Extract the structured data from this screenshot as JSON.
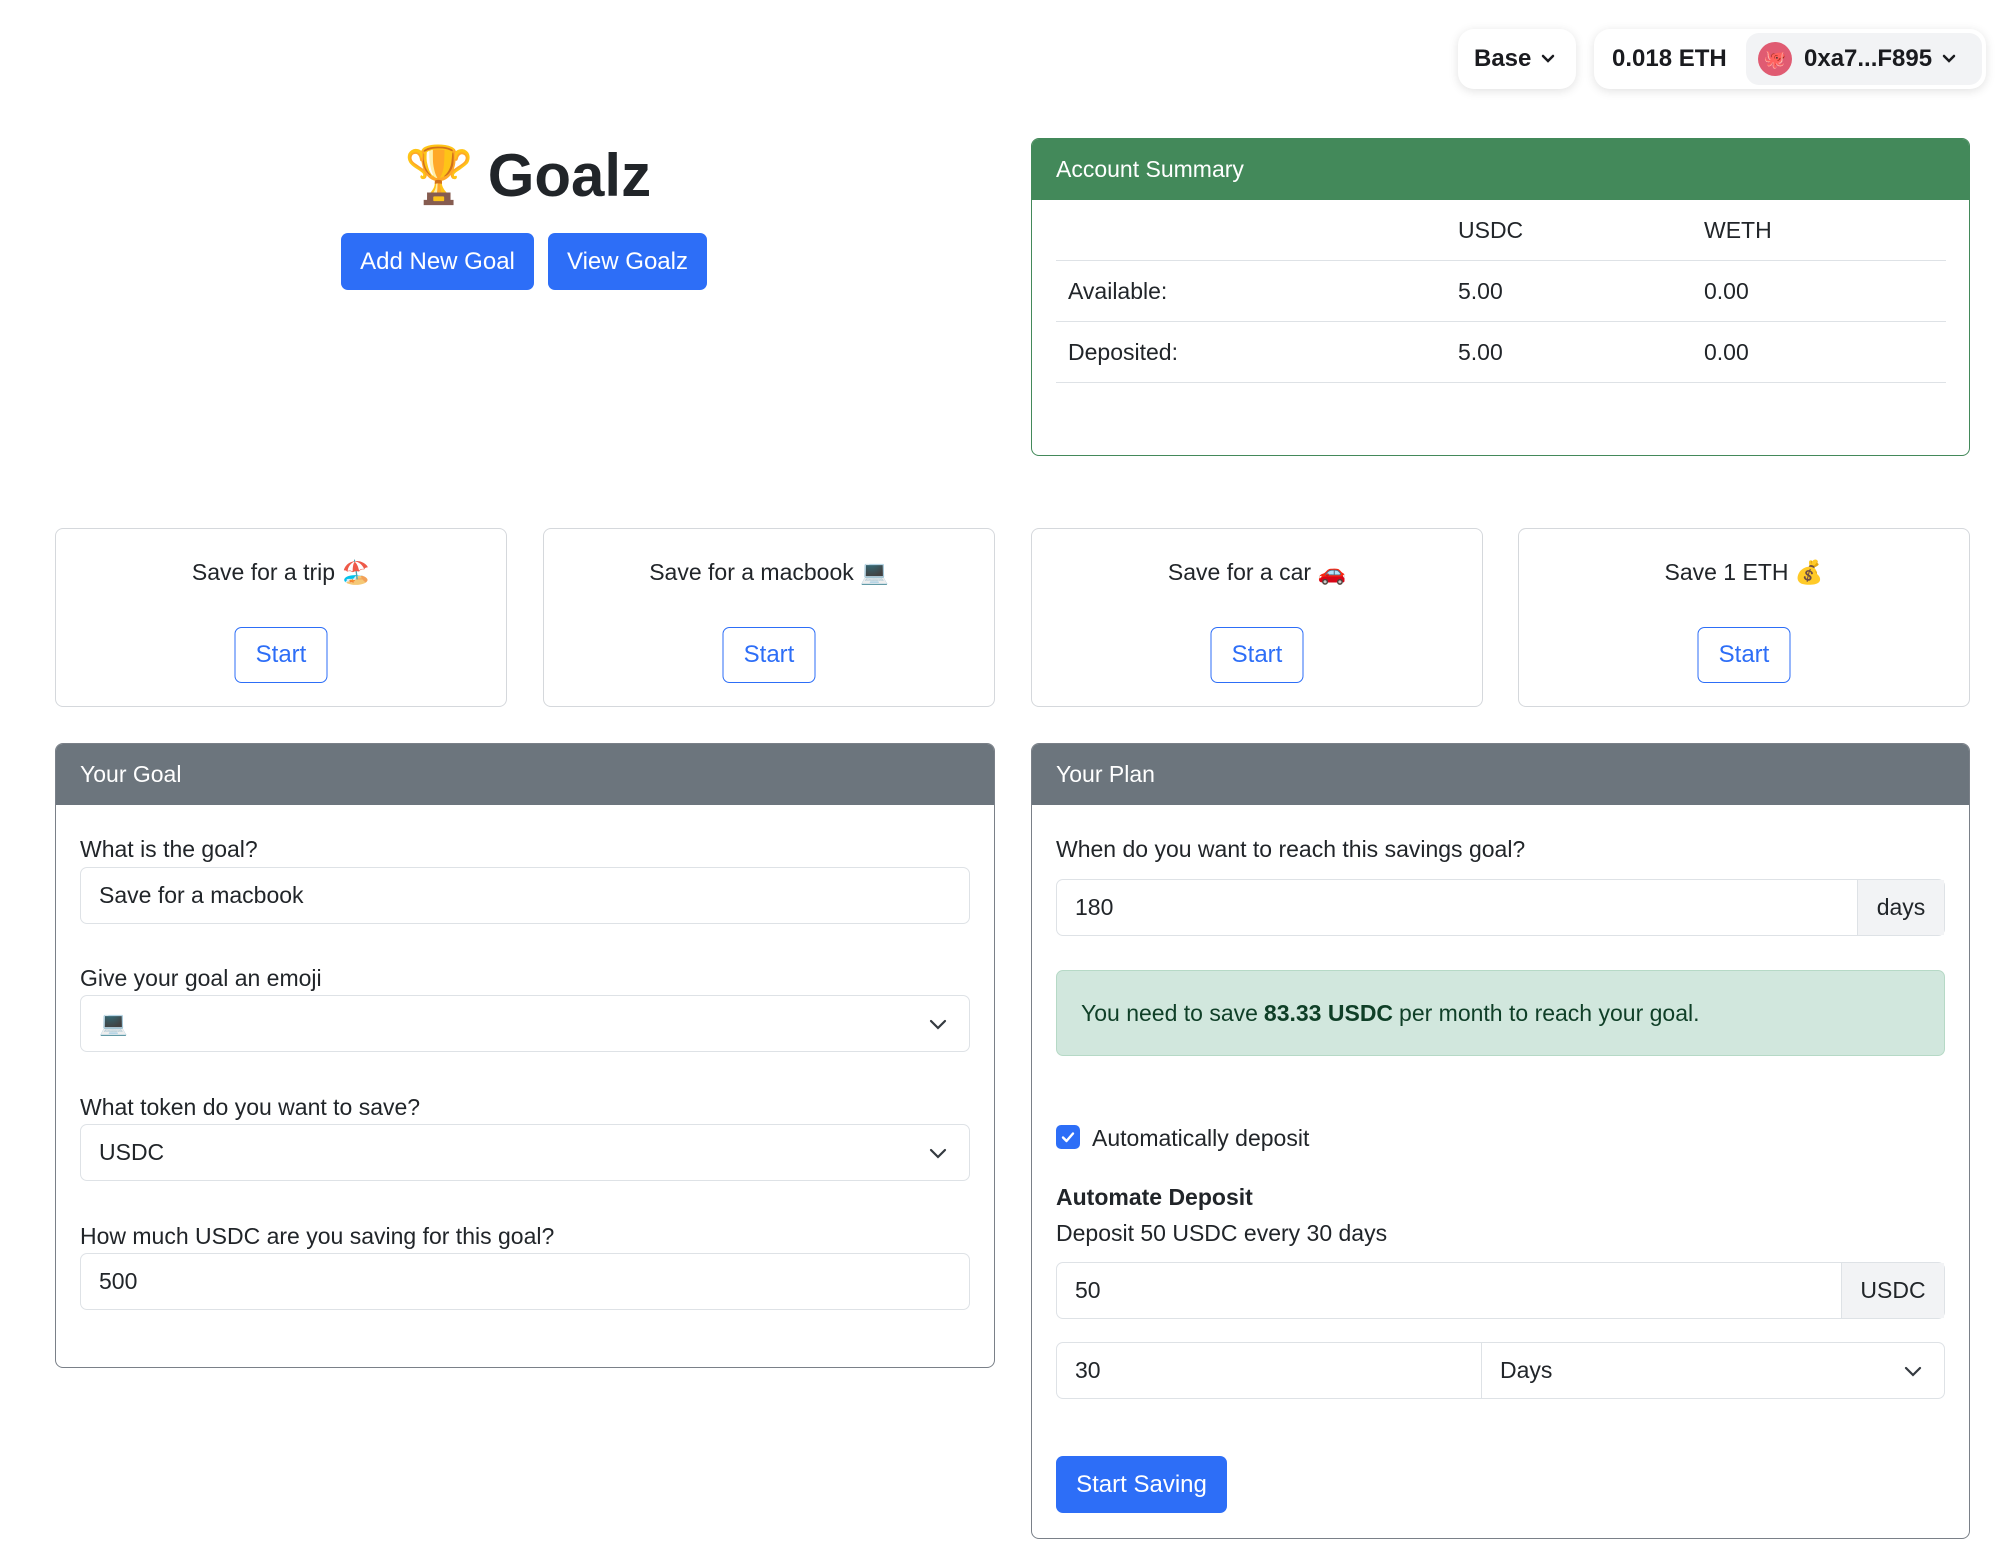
{
  "wallet": {
    "chain_label": "Base",
    "balance": "0.018 ETH",
    "address": "0xa7...F895",
    "avatar_emoji": "🐙"
  },
  "header": {
    "trophy": "🏆",
    "title": "Goalz",
    "add_label": "Add New Goal",
    "view_label": "View Goalz"
  },
  "summary": {
    "title": "Account Summary",
    "columns": [
      "",
      "USDC",
      "WETH"
    ],
    "rows": [
      {
        "label": "Available:",
        "usdc": "5.00",
        "weth": "0.00"
      },
      {
        "label": "Deposited:",
        "usdc": "5.00",
        "weth": "0.00"
      }
    ]
  },
  "presets": [
    {
      "title": "Save for a trip 🏖️",
      "button": "Start"
    },
    {
      "title": "Save for a macbook 💻",
      "button": "Start"
    },
    {
      "title": "Save for a car 🚗",
      "button": "Start"
    },
    {
      "title": "Save 1 ETH 💰",
      "button": "Start"
    }
  ],
  "goal": {
    "header": "Your Goal",
    "q_goal": "What is the goal?",
    "goal_value": "Save for a macbook",
    "q_emoji": "Give your goal an emoji",
    "emoji_value": "💻",
    "q_token": "What token do you want to save?",
    "token_value": "USDC",
    "q_amount": "How much USDC are you saving for this goal?",
    "amount_value": "500"
  },
  "plan": {
    "header": "Your Plan",
    "q_when": "When do you want to reach this savings goal?",
    "days_value": "180",
    "days_unit": "days",
    "alert_prefix": "You need to save",
    "alert_amount": "83.33 USDC",
    "alert_suffix": "per month to reach your goal.",
    "auto_label": "Automatically deposit",
    "auto_checked": true,
    "auto_title": "Automate Deposit",
    "auto_desc": "Deposit 50 USDC every 30 days",
    "deposit_value": "50",
    "deposit_unit": "USDC",
    "interval_value": "30",
    "interval_unit": "Days",
    "start_label": "Start Saving"
  },
  "colors": {
    "primary": "#2d6ef7",
    "success_header": "#43895a",
    "secondary_header": "#6c757d",
    "alert_bg": "#d1e7dd"
  }
}
